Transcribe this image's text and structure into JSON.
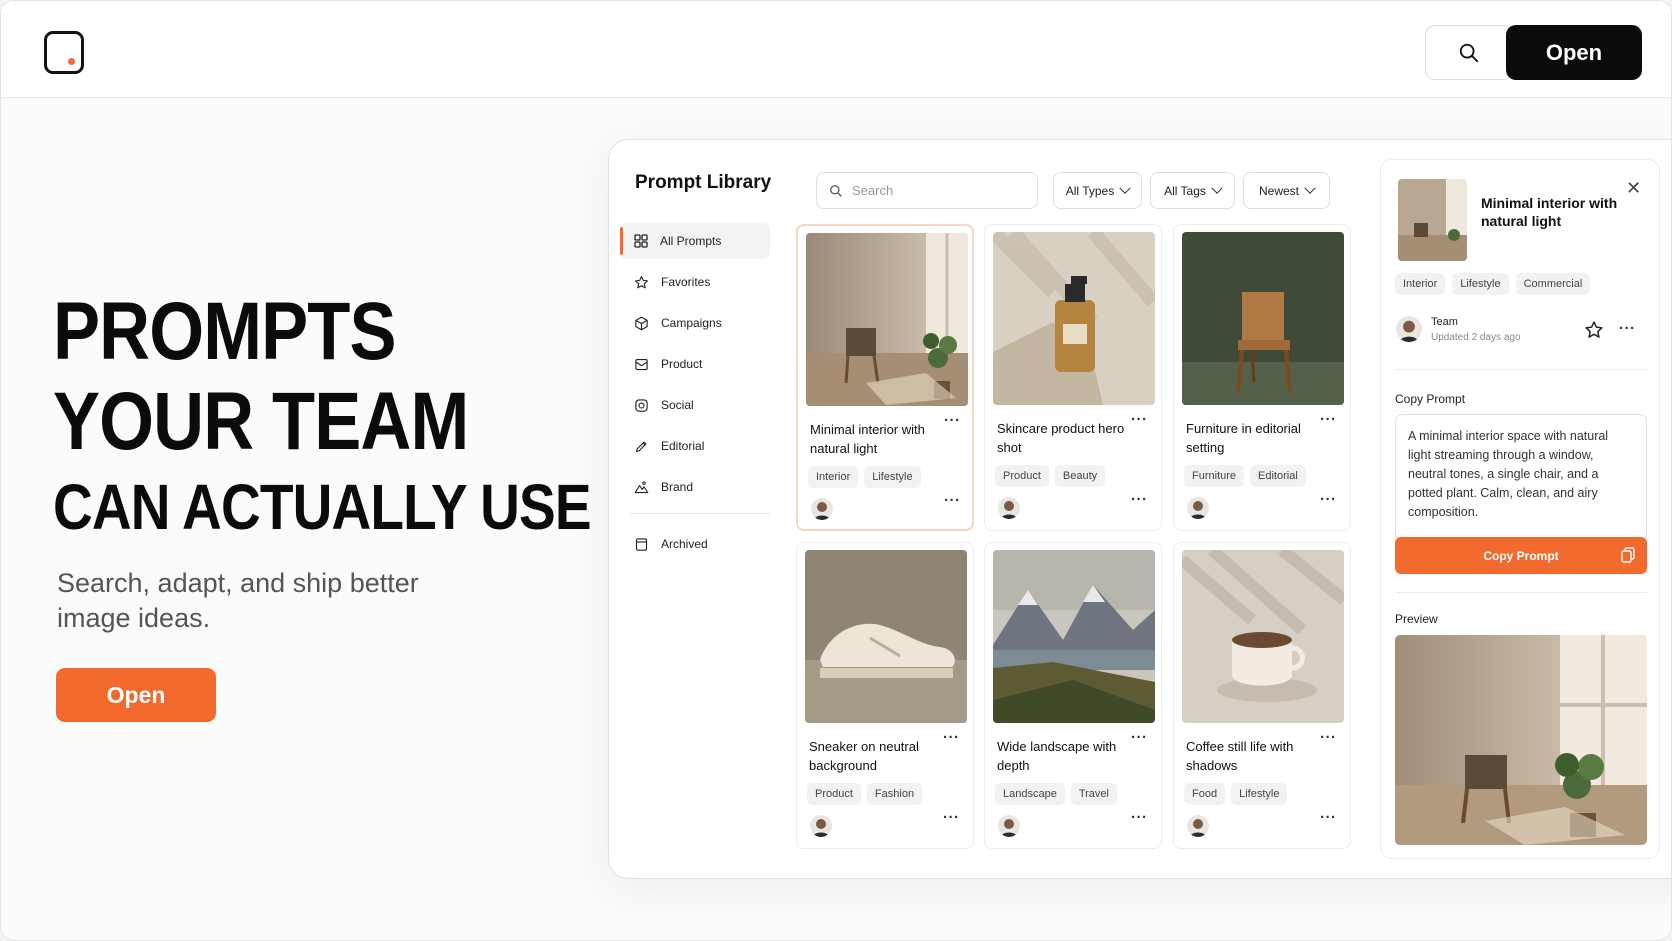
{
  "header": {
    "logo": "app-logo",
    "search_icon": "search-icon",
    "open_label": "Open"
  },
  "hero": {
    "title_line1": "PROMPTS",
    "title_line2": "YOUR TEAM",
    "title_line3": "CAN ACTUALLY USE",
    "subtitle": "Search, adapt, and ship better image ideas.",
    "cta_label": "Open"
  },
  "library": {
    "title": "Prompt Library",
    "search_placeholder": "Search",
    "filters": {
      "types": "All Types",
      "tags": "All Tags",
      "sort": "Newest"
    },
    "sidebar": [
      {
        "label": "All Prompts",
        "icon": "grid-icon",
        "active": true
      },
      {
        "label": "Favorites",
        "icon": "star-icon"
      },
      {
        "label": "Campaigns",
        "icon": "box-icon"
      },
      {
        "label": "Product",
        "icon": "mail-icon"
      },
      {
        "label": "Social",
        "icon": "target-icon"
      },
      {
        "label": "Editorial",
        "icon": "pen-icon"
      },
      {
        "label": "Brand",
        "icon": "mountain-icon"
      }
    ],
    "archived_label": "Archived",
    "cards": [
      {
        "title": "Minimal interior with natural light",
        "tags": [
          "Interior",
          "Lifestyle"
        ],
        "image": "room-chair-plant"
      },
      {
        "title": "Skincare product hero shot",
        "tags": [
          "Product",
          "Beauty"
        ],
        "image": "serum-bottle"
      },
      {
        "title": "Furniture in editorial setting",
        "tags": [
          "Furniture",
          "Editorial"
        ],
        "image": "wooden-chair"
      },
      {
        "title": "Sneaker on neutral background",
        "tags": [
          "Product",
          "Fashion"
        ],
        "image": "sneaker"
      },
      {
        "title": "Wide landscape with depth",
        "tags": [
          "Landscape",
          "Travel"
        ],
        "image": "mountain-lake"
      },
      {
        "title": "Coffee still life with shadows",
        "tags": [
          "Food",
          "Lifestyle"
        ],
        "image": "coffee-cup"
      }
    ]
  },
  "detail": {
    "title": "Minimal interior with natural light",
    "tags": [
      "Interior",
      "Lifestyle",
      "Commercial"
    ],
    "author": "Team",
    "updated": "Updated 2 days ago",
    "copy_prompt_heading": "Copy Prompt",
    "prompt_text": "A minimal interior space with natural light streaming through a window, neutral tones, a single chair, and a potted plant. Calm, clean, and airy composition.",
    "copy_button": "Copy Prompt",
    "preview_heading": "Preview"
  },
  "colors": {
    "accent": "#f26a2e",
    "dark": "#0b0b0b"
  }
}
